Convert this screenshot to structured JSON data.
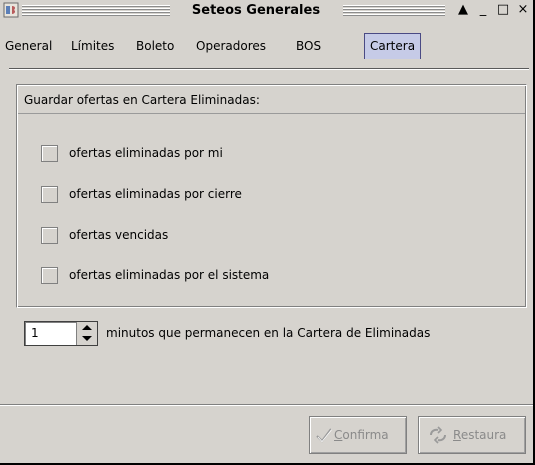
{
  "window": {
    "title": "Seteos Generales",
    "controls": {
      "collapse": "▲",
      "minimize": "_",
      "maximize": "□",
      "close": "×"
    }
  },
  "tabs": [
    {
      "label": "General",
      "active": false
    },
    {
      "label": "Límites",
      "active": false
    },
    {
      "label": "Boleto",
      "active": false
    },
    {
      "label": "Operadores",
      "active": false
    },
    {
      "label": "BOS",
      "active": false
    },
    {
      "label": "Cartera",
      "active": true
    }
  ],
  "group": {
    "title": "Guardar ofertas en Cartera Eliminadas:",
    "checkboxes": [
      {
        "label": "ofertas eliminadas por mi",
        "checked": false
      },
      {
        "label": "ofertas eliminadas por cierre",
        "checked": false
      },
      {
        "label": "ofertas vencidas",
        "checked": false
      },
      {
        "label": "ofertas eliminadas por el sistema",
        "checked": false
      }
    ]
  },
  "spinner": {
    "value": "1",
    "label": "minutos que permanecen en la Cartera de Eliminadas"
  },
  "buttons": {
    "confirm": {
      "mnemonic": "C",
      "rest": "onfirma",
      "icon": "checkmark-icon",
      "enabled": false
    },
    "restore": {
      "mnemonic": "R",
      "rest": "estaura",
      "icon": "restore-arrows-icon",
      "enabled": false
    }
  },
  "colors": {
    "background": "#d6d3ce",
    "active_tab": "#c6cbe7",
    "disabled_text": "#8a8a8a"
  }
}
